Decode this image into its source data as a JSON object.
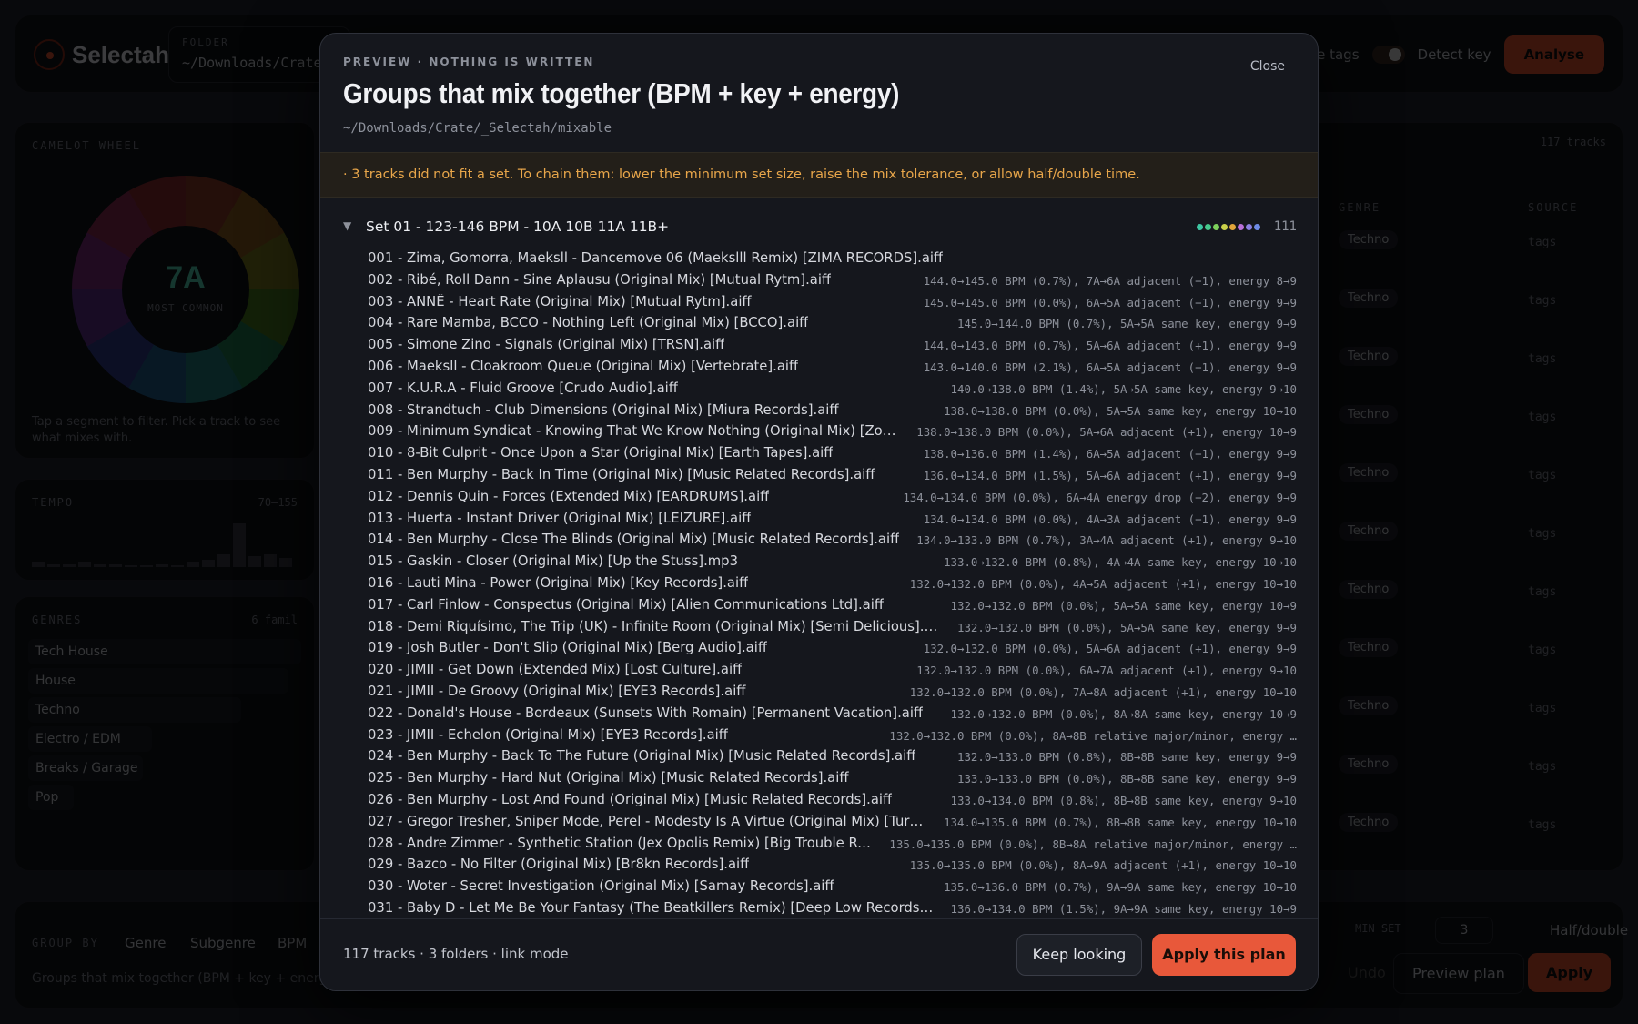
{
  "app": {
    "name": "Selectah",
    "folder_label": "FOLDER",
    "folder_path": "~/Downloads/Crate",
    "use_tags": "Use tags",
    "detect_key": "Detect key",
    "analyse": "Analyse",
    "camelot_title": "CAMELOT WHEEL",
    "wheel_key": "7A",
    "wheel_sub": "MOST COMMON",
    "wheel_hint": "Tap a segment to filter. Pick a track to see what mixes with.",
    "tempo_title": "TEMPO",
    "tempo_range": "70–155",
    "genres_title": "GENRES",
    "genres_count": "6 famil",
    "genres": [
      "Tech House",
      "House",
      "Techno",
      "Electro / EDM",
      "Breaks / Garage",
      "Pop"
    ],
    "track_count": "117 tracks",
    "col_genre": "GENRE",
    "col_source": "SOURCE",
    "row_genre": "Techno",
    "row_source": "tags",
    "groupby_title": "GROUP BY",
    "groupby_tabs": [
      "Genre",
      "Subgenre",
      "BPM"
    ],
    "groupby_desc": "Groups that mix together (BPM + key + energy)",
    "min_set_label": "MIN SET",
    "min_set_value": "3",
    "half_double": "Half/double",
    "undo": "Undo",
    "preview_plan": "Preview plan",
    "apply": "Apply"
  },
  "modal": {
    "eyebrow": "PREVIEW · NOTHING IS WRITTEN",
    "title": "Groups that mix together (BPM + key + energy)",
    "path": "~/Downloads/Crate/_Selectah/mixable",
    "close": "Close",
    "warning": "· 3 tracks did not fit a set. To chain them: lower the minimum set size, raise the mix tolerance, or allow half/double time.",
    "set": {
      "title": "Set 01 - 123-146 BPM - 10A 10B 11A 11B+",
      "count": "111",
      "dot_colors": [
        "#3ec7a3",
        "#46c98c",
        "#7ccf5a",
        "#c9d04a",
        "#e0a43a",
        "#b86fd8",
        "#8a7fe0",
        "#6e8be6"
      ]
    },
    "tracks": [
      {
        "name": "001 - Zima, Gomorra, Maeksll - Dancemove 06 (Maekslll Remix) [ZIMA RECORDS].aiff",
        "meta": ""
      },
      {
        "name": "002 - Ribé, Roll Dann - Sine Aplausu (Original Mix) [Mutual Rytm].aiff",
        "meta": "144.0→145.0 BPM (0.7%), 7A→6A adjacent (−1), energy 8→9"
      },
      {
        "name": "003 - ANNË - Heart Rate (Original Mix) [Mutual Rytm].aiff",
        "meta": "145.0→145.0 BPM (0.0%), 6A→5A adjacent (−1), energy 9→9"
      },
      {
        "name": "004 - Rare Mamba, BCCO - Nothing Left (Original Mix) [BCCO].aiff",
        "meta": "145.0→144.0 BPM (0.7%), 5A→5A same key, energy 9→9"
      },
      {
        "name": "005 - Simone Zino - Signals (Original Mix) [TRSN].aiff",
        "meta": "144.0→143.0 BPM (0.7%), 5A→6A adjacent (+1), energy 9→9"
      },
      {
        "name": "006 - Maeksll - Cloakroom Queue (Original Mix) [Vertebrate].aiff",
        "meta": "143.0→140.0 BPM (2.1%), 6A→5A adjacent (−1), energy 9→9"
      },
      {
        "name": "007 - K.U.R.A - Fluid Groove [Crudo Audio].aiff",
        "meta": "140.0→138.0 BPM (1.4%), 5A→5A same key, energy 9→10"
      },
      {
        "name": "008 - Strandtuch - Club Dimensions (Original Mix) [Miura Records].aiff",
        "meta": "138.0→138.0 BPM (0.0%), 5A→5A same key, energy 10→10"
      },
      {
        "name": "009 - Minimum Syndicat - Knowing That We Know Nothing (Original Mix) [Zodiak …",
        "meta": "138.0→138.0 BPM (0.0%), 5A→6A adjacent (+1), energy 10→9"
      },
      {
        "name": "010 - 8-Bit Culprit - Once Upon a Star (Original Mix) [Earth Tapes].aiff",
        "meta": "138.0→136.0 BPM (1.4%), 6A→5A adjacent (−1), energy 9→9"
      },
      {
        "name": "011 - Ben Murphy - Back In Time (Original Mix) [Music Related Records].aiff",
        "meta": "136.0→134.0 BPM (1.5%), 5A→6A adjacent (+1), energy 9→9"
      },
      {
        "name": "012 - Dennis Quin - Forces (Extended Mix) [EARDRUMS].aiff",
        "meta": "134.0→134.0 BPM (0.0%), 6A→4A energy drop (−2), energy 9→9"
      },
      {
        "name": "013 - Huerta - Instant Driver (Original Mix) [LEIZURE].aiff",
        "meta": "134.0→134.0 BPM (0.0%), 4A→3A adjacent (−1), energy 9→9"
      },
      {
        "name": "014 - Ben Murphy - Close The Blinds (Original Mix) [Music Related Records].aiff",
        "meta": "134.0→133.0 BPM (0.7%), 3A→4A adjacent (+1), energy 9→10"
      },
      {
        "name": "015 - Gaskin - Closer (Original Mix) [Up the Stuss].mp3",
        "meta": "133.0→132.0 BPM (0.8%), 4A→4A same key, energy 10→10"
      },
      {
        "name": "016 - Lauti Mina - Power (Original Mix) [Key Records].aiff",
        "meta": "132.0→132.0 BPM (0.0%), 4A→5A adjacent (+1), energy 10→10"
      },
      {
        "name": "017 - Carl Finlow - Conspectus (Original Mix) [Alien Communications Ltd].aiff",
        "meta": "132.0→132.0 BPM (0.0%), 5A→5A same key, energy 10→9"
      },
      {
        "name": "018 - Demi Riquísimo, The Trip (UK) - Infinite Room (Original Mix) [Semi Delicious].aiff",
        "meta": "132.0→132.0 BPM (0.0%), 5A→5A same key, energy 9→9"
      },
      {
        "name": "019 - Josh Butler - Don't Slip (Original Mix) [Berg Audio].aiff",
        "meta": "132.0→132.0 BPM (0.0%), 5A→6A adjacent (+1), energy 9→9"
      },
      {
        "name": "020 - JIMII - Get Down (Extended Mix) [Lost Culture].aiff",
        "meta": "132.0→132.0 BPM (0.0%), 6A→7A adjacent (+1), energy 9→10"
      },
      {
        "name": "021 - JIMII - De Groovy (Original Mix) [EYE3 Records].aiff",
        "meta": "132.0→132.0 BPM (0.0%), 7A→8A adjacent (+1), energy 10→10"
      },
      {
        "name": "022 - Donald's House - Bordeaux (Sunsets With Romain) [Permanent Vacation].aiff",
        "meta": "132.0→132.0 BPM (0.0%), 8A→8A same key, energy 10→9"
      },
      {
        "name": "023 - JIMII - Echelon (Original Mix) [EYE3 Records].aiff",
        "meta": "132.0→132.0 BPM (0.0%), 8A→8B relative major/minor, energy …"
      },
      {
        "name": "024 - Ben Murphy - Back To The Future (Original Mix) [Music Related Records].aiff",
        "meta": "132.0→133.0 BPM (0.8%), 8B→8B same key, energy 9→9"
      },
      {
        "name": "025 - Ben Murphy - Hard Nut (Original Mix) [Music Related Records].aiff",
        "meta": "133.0→133.0 BPM (0.0%), 8B→8B same key, energy 9→9"
      },
      {
        "name": "026 - Ben Murphy - Lost And Found (Original Mix) [Music Related Records].aiff",
        "meta": "133.0→134.0 BPM (0.8%), 8B→8B same key, energy 9→10"
      },
      {
        "name": "027 - Gregor Tresher, Sniper Mode, Perel - Modesty Is A Virtue (Original Mix) [Turbo Re…",
        "meta": "134.0→135.0 BPM (0.7%), 8B→8B same key, energy 10→10"
      },
      {
        "name": "028 - Andre Zimmer - Synthetic Station (Jex Opolis Remix) [Big Trouble Reco…",
        "meta": "135.0→135.0 BPM (0.0%), 8B→8A relative major/minor, energy …"
      },
      {
        "name": "029 - Bazco - No Filter (Original Mix) [Br8kn Records].aiff",
        "meta": "135.0→135.0 BPM (0.0%), 8A→9A adjacent (+1), energy 10→10"
      },
      {
        "name": "030 - Woter - Secret Investigation (Original Mix) [Samay Records].aiff",
        "meta": "135.0→136.0 BPM (0.7%), 9A→9A same key, energy 10→10"
      },
      {
        "name": "031 - Baby D - Let Me Be Your Fantasy (The Beatkillers Remix) [Deep Low Records].aiff",
        "meta": "136.0→134.0 BPM (1.5%), 9A→9A same key, energy 10→9"
      }
    ],
    "footer": {
      "summary": "117 tracks · 3 folders · link mode",
      "keep": "Keep looking",
      "apply": "Apply this plan"
    }
  }
}
